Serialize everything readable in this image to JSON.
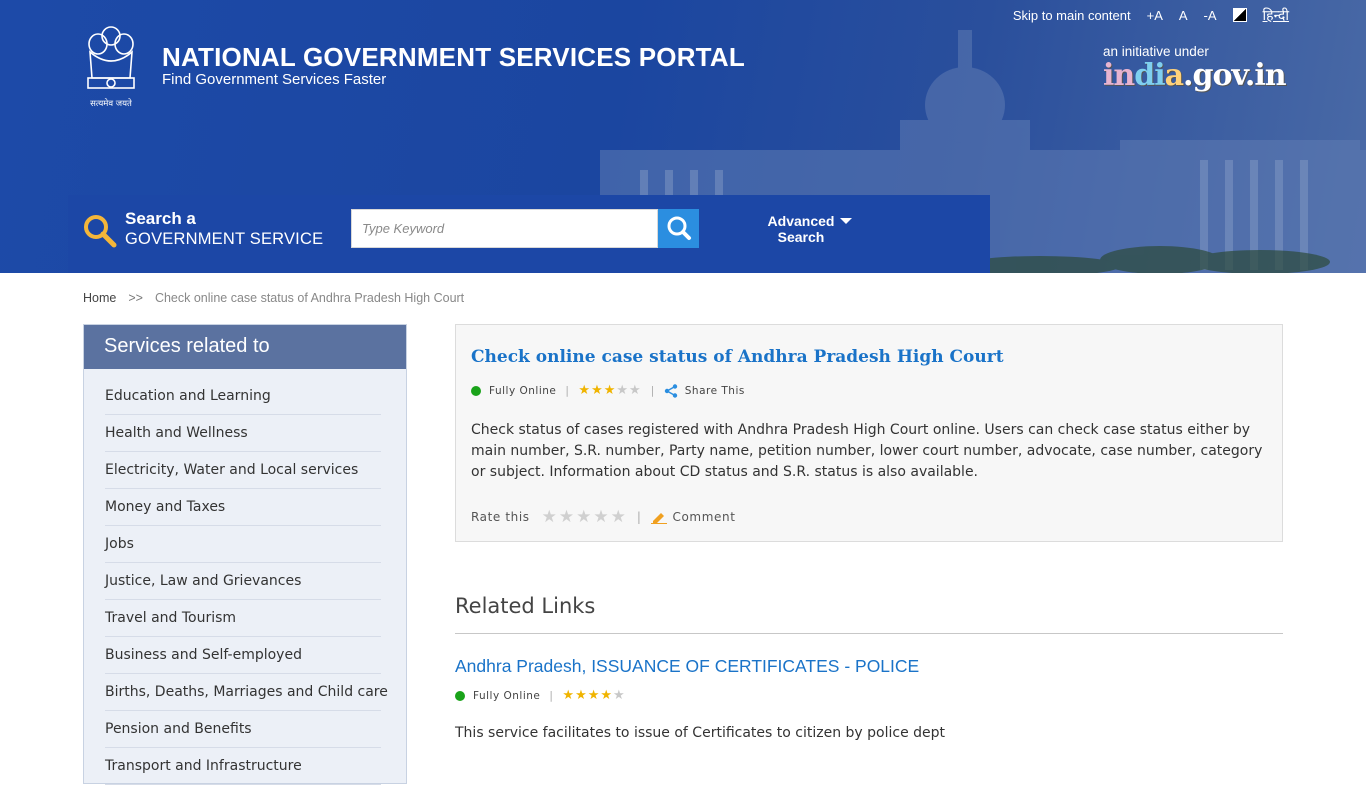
{
  "topbar": {
    "skip": "Skip to main content",
    "font_increase": "+A",
    "font_normal": "A",
    "font_decrease": "-A",
    "language": "हिन्दी"
  },
  "brand": {
    "emblem_caption": "सत्यमेव जयते",
    "title": "NATIONAL GOVERNMENT SERVICES PORTAL",
    "subtitle": "Find Government Services Faster",
    "initiative_label": "an initiative under",
    "initiative_logo": "india.gov.in"
  },
  "search": {
    "label_line1": "Search a",
    "label_line2": "GOVERNMENT SERVICE",
    "placeholder": "Type Keyword",
    "advanced_line1": "Advanced",
    "advanced_line2": "Search"
  },
  "breadcrumb": {
    "home": "Home",
    "separator": ">>",
    "current": "Check online case status of Andhra Pradesh High Court"
  },
  "sidebar": {
    "heading": "Services related to",
    "items": [
      "Education and Learning",
      "Health and Wellness",
      "Electricity, Water and Local services",
      "Money and Taxes",
      "Jobs",
      "Justice, Law and Grievances",
      "Travel and Tourism",
      "Business and Self-employed",
      "Births, Deaths, Marriages and Child care",
      "Pension and Benefits",
      "Transport and Infrastructure"
    ]
  },
  "service": {
    "title": "Check online case status of Andhra Pradesh High Court",
    "status": "Fully Online",
    "rating": 3,
    "rating_max": 5,
    "share_label": "Share This",
    "description": "Check status of cases registered with Andhra Pradesh High Court online. Users can check case status either by main number, S.R. number, Party name, petition number, lower court number, advocate, case number, category or subject. Information about CD status and S.R. status is also available.",
    "rate_label": "Rate this",
    "comment_label": "Comment"
  },
  "related": {
    "heading": "Related Links",
    "items": [
      {
        "title": "Andhra Pradesh, ISSUANCE OF CERTIFICATES - POLICE",
        "status": "Fully Online",
        "rating": 4,
        "rating_max": 5,
        "description": "This service facilitates to issue of Certificates to citizen by police dept"
      }
    ]
  },
  "colors": {
    "header_blue": "#1d4aa8",
    "sidebar_head": "#5b72a0",
    "link_blue": "#1a73c8",
    "status_green": "#1aa31a",
    "star_gold": "#f0b400"
  }
}
